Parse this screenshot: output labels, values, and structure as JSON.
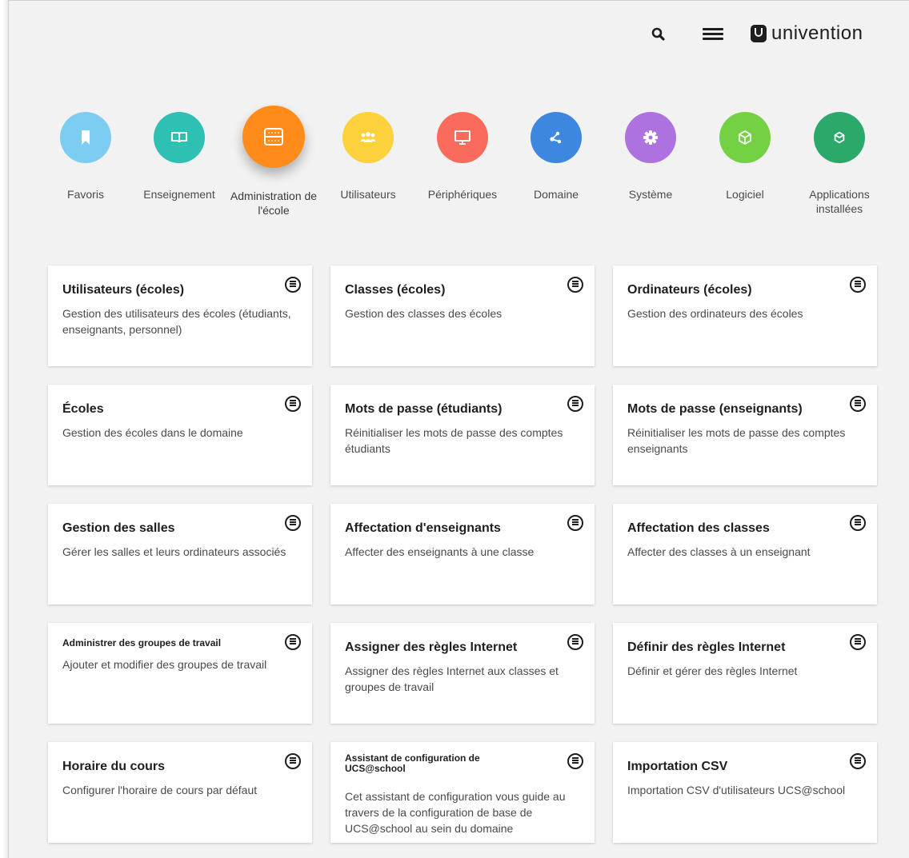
{
  "header": {
    "search_icon": "search-icon",
    "menu_icon": "hamburger-menu-icon",
    "brand": "univention"
  },
  "categories": [
    {
      "label": "Favoris",
      "color": "#7dcdf2",
      "icon": "bookmark-icon"
    },
    {
      "label": "Enseignement",
      "color": "#2fc0b4",
      "icon": "book-icon"
    },
    {
      "label": "Administration de l'école",
      "color": "#ff8c1a",
      "icon": "abacus-icon",
      "active": true
    },
    {
      "label": "Utilisateurs",
      "color": "#fdd13c",
      "icon": "users-icon"
    },
    {
      "label": "Périphériques",
      "color": "#fb6b5b",
      "icon": "monitor-icon"
    },
    {
      "label": "Domaine",
      "color": "#3d87e0",
      "icon": "network-icon"
    },
    {
      "label": "Système",
      "color": "#ad72e0",
      "icon": "gear-icon"
    },
    {
      "label": "Logiciel",
      "color": "#73d143",
      "icon": "package-icon"
    },
    {
      "label": "Applications installées",
      "color": "#2aa96b",
      "icon": "package-filled-icon"
    }
  ],
  "tiles": [
    {
      "title": "Utilisateurs (écoles)",
      "desc": "Gestion des utilisateurs des écoles (étudiants, enseignants, personnel)"
    },
    {
      "title": "Classes (écoles)",
      "desc": "Gestion des classes des écoles"
    },
    {
      "title": "Ordinateurs (écoles)",
      "desc": "Gestion des ordinateurs des écoles"
    },
    {
      "title": "Écoles",
      "desc": "Gestion des écoles dans le domaine"
    },
    {
      "title": "Mots de passe (étudiants)",
      "desc": "Réinitialiser les mots de passe des comptes étudiants"
    },
    {
      "title": "Mots de passe (enseignants)",
      "desc": "Réinitialiser les mots de passe des comptes enseignants"
    },
    {
      "title": "Gestion des salles",
      "desc": "Gérer les salles et leurs ordinateurs associés"
    },
    {
      "title": "Affectation d'enseignants",
      "desc": "Affecter des enseignants à une classe"
    },
    {
      "title": "Affectation des classes",
      "desc": "Affecter des classes à un enseignant"
    },
    {
      "title": "Administrer des groupes de travail",
      "desc": "Ajouter et modifier des groupes de travail"
    },
    {
      "title": "Assigner des règles Internet",
      "desc": "Assigner des règles Internet aux classes et groupes de travail"
    },
    {
      "title": "Définir des règles Internet",
      "desc": "Définir et gérer des règles Internet"
    },
    {
      "title": "Horaire du cours",
      "desc": "Configurer l'horaire de cours par défaut"
    },
    {
      "title": "Assistant de configuration de UCS@school",
      "desc": "Cet assistant de configuration vous guide au travers de la configuration de base de UCS@school au sein du domaine"
    },
    {
      "title": "Importation CSV",
      "desc": "Importation CSV d'utilisateurs UCS@school"
    }
  ],
  "tile_menu_icon": "favorite-menu-icon"
}
